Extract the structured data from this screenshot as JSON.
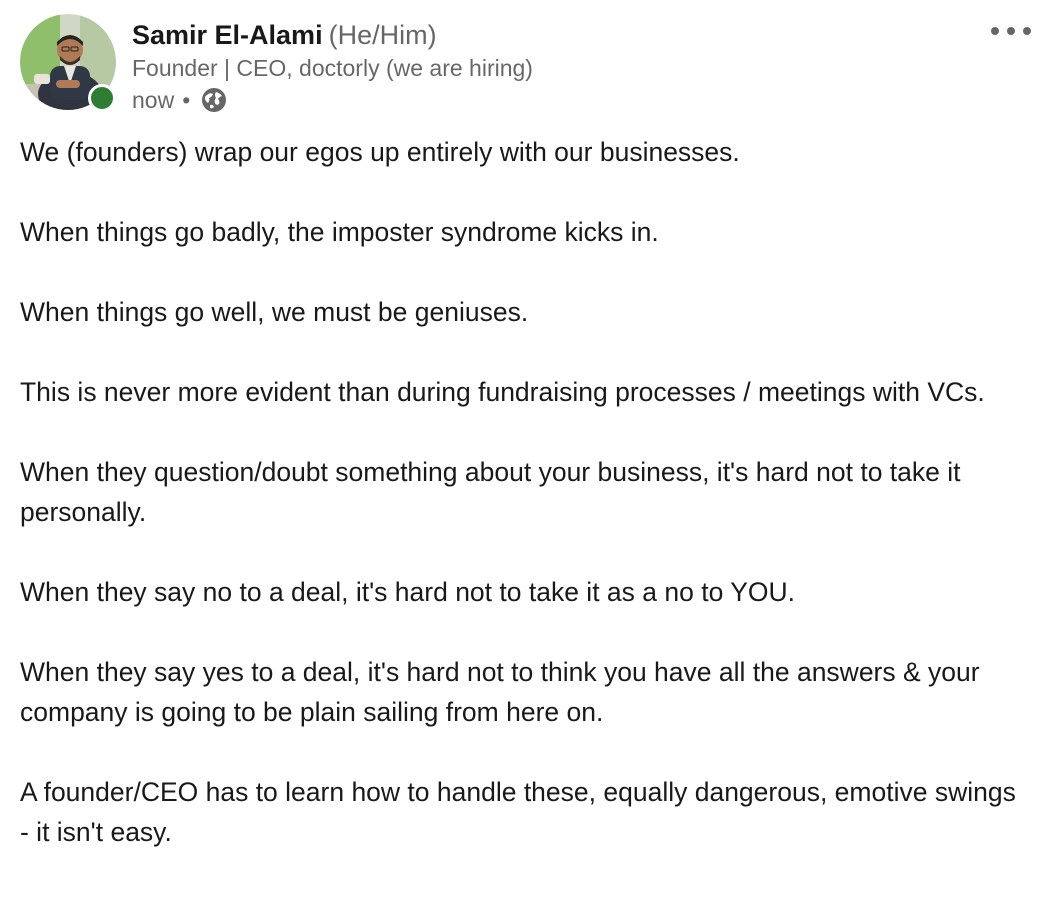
{
  "author": {
    "name": "Samir El-Alami",
    "pronouns": "(He/Him)",
    "headline": "Founder | CEO, doctorly (we are hiring)",
    "timestamp": "now",
    "separator": "•",
    "visibility_icon": "globe-icon",
    "online_status_color": "#2e7d32"
  },
  "menu": {
    "icon": "more-horizontal-icon"
  },
  "post": {
    "paragraphs": [
      "We (founders) wrap our egos up entirely with our businesses.",
      "When things go badly, the imposter syndrome kicks in.",
      "When things go well, we must be geniuses.",
      "This is never more evident than during fundraising processes / meetings with VCs.",
      "When they question/doubt something about your business, it's hard not to take it personally.",
      "When they say no to a deal, it's hard not to take it as a no to YOU.",
      "When they say yes to a deal, it's hard not to think you have all the answers & your company is going to be plain sailing from here on.",
      "A founder/CEO has to learn how to handle these, equally dangerous, emotive swings - it isn't easy."
    ]
  }
}
